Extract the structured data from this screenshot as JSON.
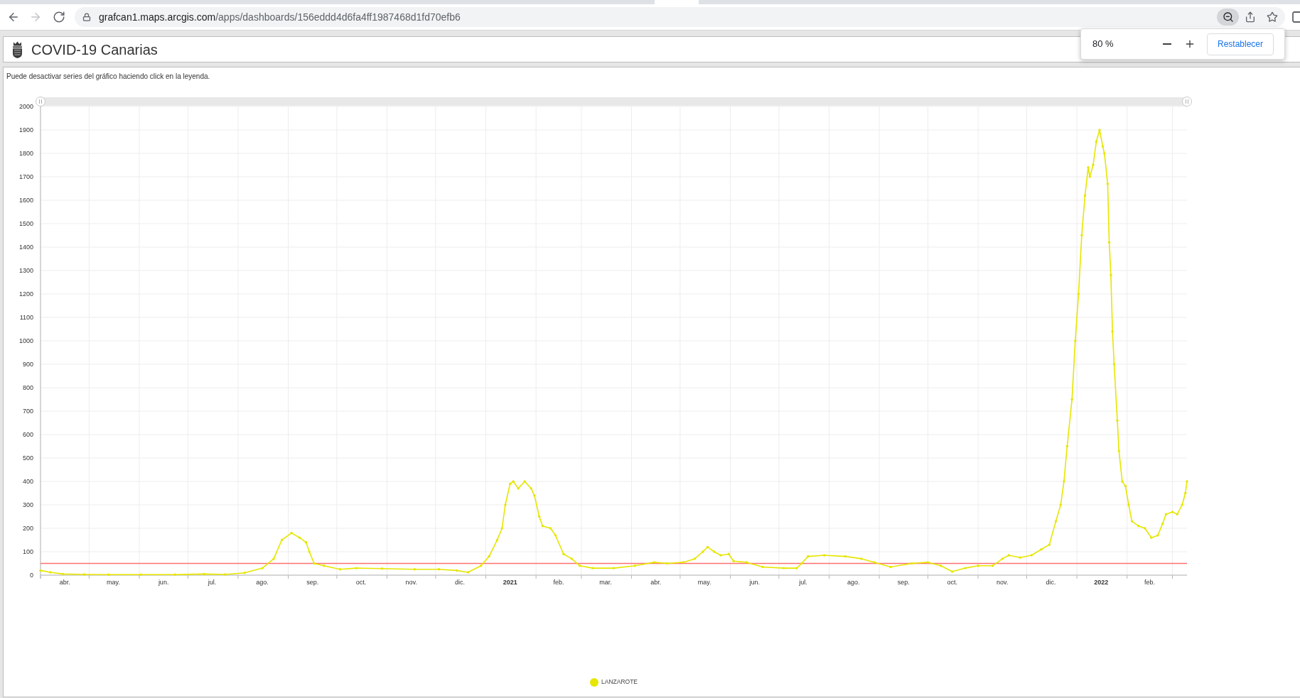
{
  "browser": {
    "nav_buttons": [
      {
        "kind": "back",
        "disabled": false
      },
      {
        "kind": "forward",
        "disabled": true
      },
      {
        "kind": "reload",
        "disabled": false
      }
    ],
    "url": {
      "host": "grafcan1.maps.arcgis.com",
      "path": "/apps/dashboards/156eddd4d6fa4ff1987468d1fd70efb6"
    },
    "toolbar_icons": [
      {
        "kind": "zoom",
        "active": true
      },
      {
        "kind": "share",
        "active": false
      },
      {
        "kind": "bookmark",
        "active": false
      }
    ]
  },
  "zoom_popup": {
    "zoom_percent": "80 %",
    "reset_button": "Restablecer"
  },
  "header": {
    "title": "COVID-19 Canarias"
  },
  "chart_panel": {
    "hint": "Puede desactivar series del gráfico haciendo click en la leyenda.",
    "chart_data": {
      "type": "line",
      "x": [
        "2020-04-01",
        "2020-04-07",
        "2020-04-15",
        "2020-04-28",
        "2020-05-13",
        "2020-06-02",
        "2020-06-23",
        "2020-07-11",
        "2020-07-24",
        "2020-08-05",
        "2020-08-16",
        "2020-08-23",
        "2020-08-28",
        "2020-09-03",
        "2020-09-08",
        "2020-09-12",
        "2020-09-14",
        "2020-09-17",
        "2020-09-23",
        "2020-10-03",
        "2020-10-13",
        "2020-10-29",
        "2020-11-18",
        "2020-12-03",
        "2020-12-14",
        "2020-12-21",
        "2020-12-29",
        "2021-01-03",
        "2021-01-08",
        "2021-01-11",
        "2021-01-13",
        "2021-01-16",
        "2021-01-18",
        "2021-01-21",
        "2021-01-25",
        "2021-01-29",
        "2021-01-31",
        "2021-02-03",
        "2021-02-05",
        "2021-02-10",
        "2021-02-13",
        "2021-02-18",
        "2021-02-23",
        "2021-02-28",
        "2021-03-08",
        "2021-03-21",
        "2021-04-03",
        "2021-04-15",
        "2021-04-23",
        "2021-05-03",
        "2021-05-10",
        "2021-05-15",
        "2021-05-18",
        "2021-05-22",
        "2021-05-26",
        "2021-05-31",
        "2021-06-03",
        "2021-06-11",
        "2021-06-21",
        "2021-07-04",
        "2021-07-12",
        "2021-07-15",
        "2021-07-19",
        "2021-07-29",
        "2021-08-11",
        "2021-08-21",
        "2021-08-29",
        "2021-09-08",
        "2021-09-21",
        "2021-10-01",
        "2021-10-09",
        "2021-10-16",
        "2021-10-24",
        "2021-11-01",
        "2021-11-10",
        "2021-11-16",
        "2021-11-20",
        "2021-11-27",
        "2021-12-04",
        "2021-12-10",
        "2021-12-15",
        "2021-12-19",
        "2021-12-22",
        "2021-12-24",
        "2021-12-26",
        "2021-12-29",
        "2021-12-31",
        "2022-01-02",
        "2022-01-04",
        "2022-01-06",
        "2022-01-08",
        "2022-01-09",
        "2022-01-11",
        "2022-01-13",
        "2022-01-15",
        "2022-01-17",
        "2022-01-18",
        "2022-01-20",
        "2022-01-21",
        "2022-01-22",
        "2022-01-23",
        "2022-01-24",
        "2022-01-26",
        "2022-01-27",
        "2022-01-29",
        "2022-01-31",
        "2022-02-02",
        "2022-02-04",
        "2022-02-08",
        "2022-02-12",
        "2022-02-16",
        "2022-02-20",
        "2022-02-23",
        "2022-02-25",
        "2022-03-01",
        "2022-03-04",
        "2022-03-07",
        "2022-03-09",
        "2022-03-10"
      ],
      "series": [
        {
          "name": "LANZAROTE",
          "color": "#e6e600",
          "values": [
            20,
            12,
            5,
            3,
            2,
            2,
            2,
            5,
            3,
            10,
            30,
            70,
            150,
            180,
            160,
            140,
            100,
            50,
            40,
            25,
            30,
            28,
            25,
            25,
            20,
            12,
            40,
            80,
            150,
            200,
            300,
            390,
            400,
            370,
            400,
            370,
            340,
            250,
            210,
            200,
            170,
            90,
            70,
            40,
            30,
            30,
            40,
            55,
            50,
            55,
            70,
            100,
            120,
            100,
            85,
            90,
            60,
            55,
            35,
            30,
            30,
            50,
            80,
            85,
            80,
            70,
            55,
            35,
            50,
            55,
            40,
            15,
            30,
            40,
            40,
            70,
            85,
            75,
            85,
            110,
            130,
            230,
            300,
            400,
            550,
            750,
            1000,
            1200,
            1450,
            1620,
            1740,
            1700,
            1750,
            1850,
            1900,
            1830,
            1800,
            1670,
            1420,
            1280,
            1040,
            900,
            660,
            530,
            400,
            380,
            300,
            230,
            210,
            200,
            160,
            170,
            220,
            260,
            270,
            260,
            300,
            350,
            400
          ]
        }
      ],
      "xlim": [
        "2020-04-01",
        "2022-03-10"
      ],
      "ylim": [
        0,
        2000
      ],
      "xticks": [
        {
          "value": "2020-04-16",
          "label": "abr."
        },
        {
          "value": "2020-05-16",
          "label": "may."
        },
        {
          "value": "2020-06-16",
          "label": "jun."
        },
        {
          "value": "2020-07-16",
          "label": "jul."
        },
        {
          "value": "2020-08-16",
          "label": "ago."
        },
        {
          "value": "2020-09-16",
          "label": "sep."
        },
        {
          "value": "2020-10-16",
          "label": "oct."
        },
        {
          "value": "2020-11-16",
          "label": "nov."
        },
        {
          "value": "2020-12-16",
          "label": "dic."
        },
        {
          "value": "2021-01-16",
          "label": "2021"
        },
        {
          "value": "2021-02-15",
          "label": "feb."
        },
        {
          "value": "2021-03-16",
          "label": "mar."
        },
        {
          "value": "2021-04-16",
          "label": "abr."
        },
        {
          "value": "2021-05-16",
          "label": "may."
        },
        {
          "value": "2021-06-16",
          "label": "jun."
        },
        {
          "value": "2021-07-16",
          "label": "jul."
        },
        {
          "value": "2021-08-16",
          "label": "ago."
        },
        {
          "value": "2021-09-16",
          "label": "sep."
        },
        {
          "value": "2021-10-16",
          "label": "oct."
        },
        {
          "value": "2021-11-16",
          "label": "nov."
        },
        {
          "value": "2021-12-16",
          "label": "dic."
        },
        {
          "value": "2022-01-16",
          "label": "2022"
        },
        {
          "value": "2022-02-15",
          "label": "feb."
        }
      ],
      "yticks": [
        0,
        100,
        200,
        300,
        400,
        500,
        600,
        700,
        800,
        900,
        1000,
        1100,
        1200,
        1300,
        1400,
        1500,
        1600,
        1700,
        1800,
        1900,
        2000
      ],
      "grid": true,
      "ref_lines": [
        {
          "axis": "y",
          "value": 50,
          "color": "#ff6f6f"
        }
      ]
    }
  }
}
